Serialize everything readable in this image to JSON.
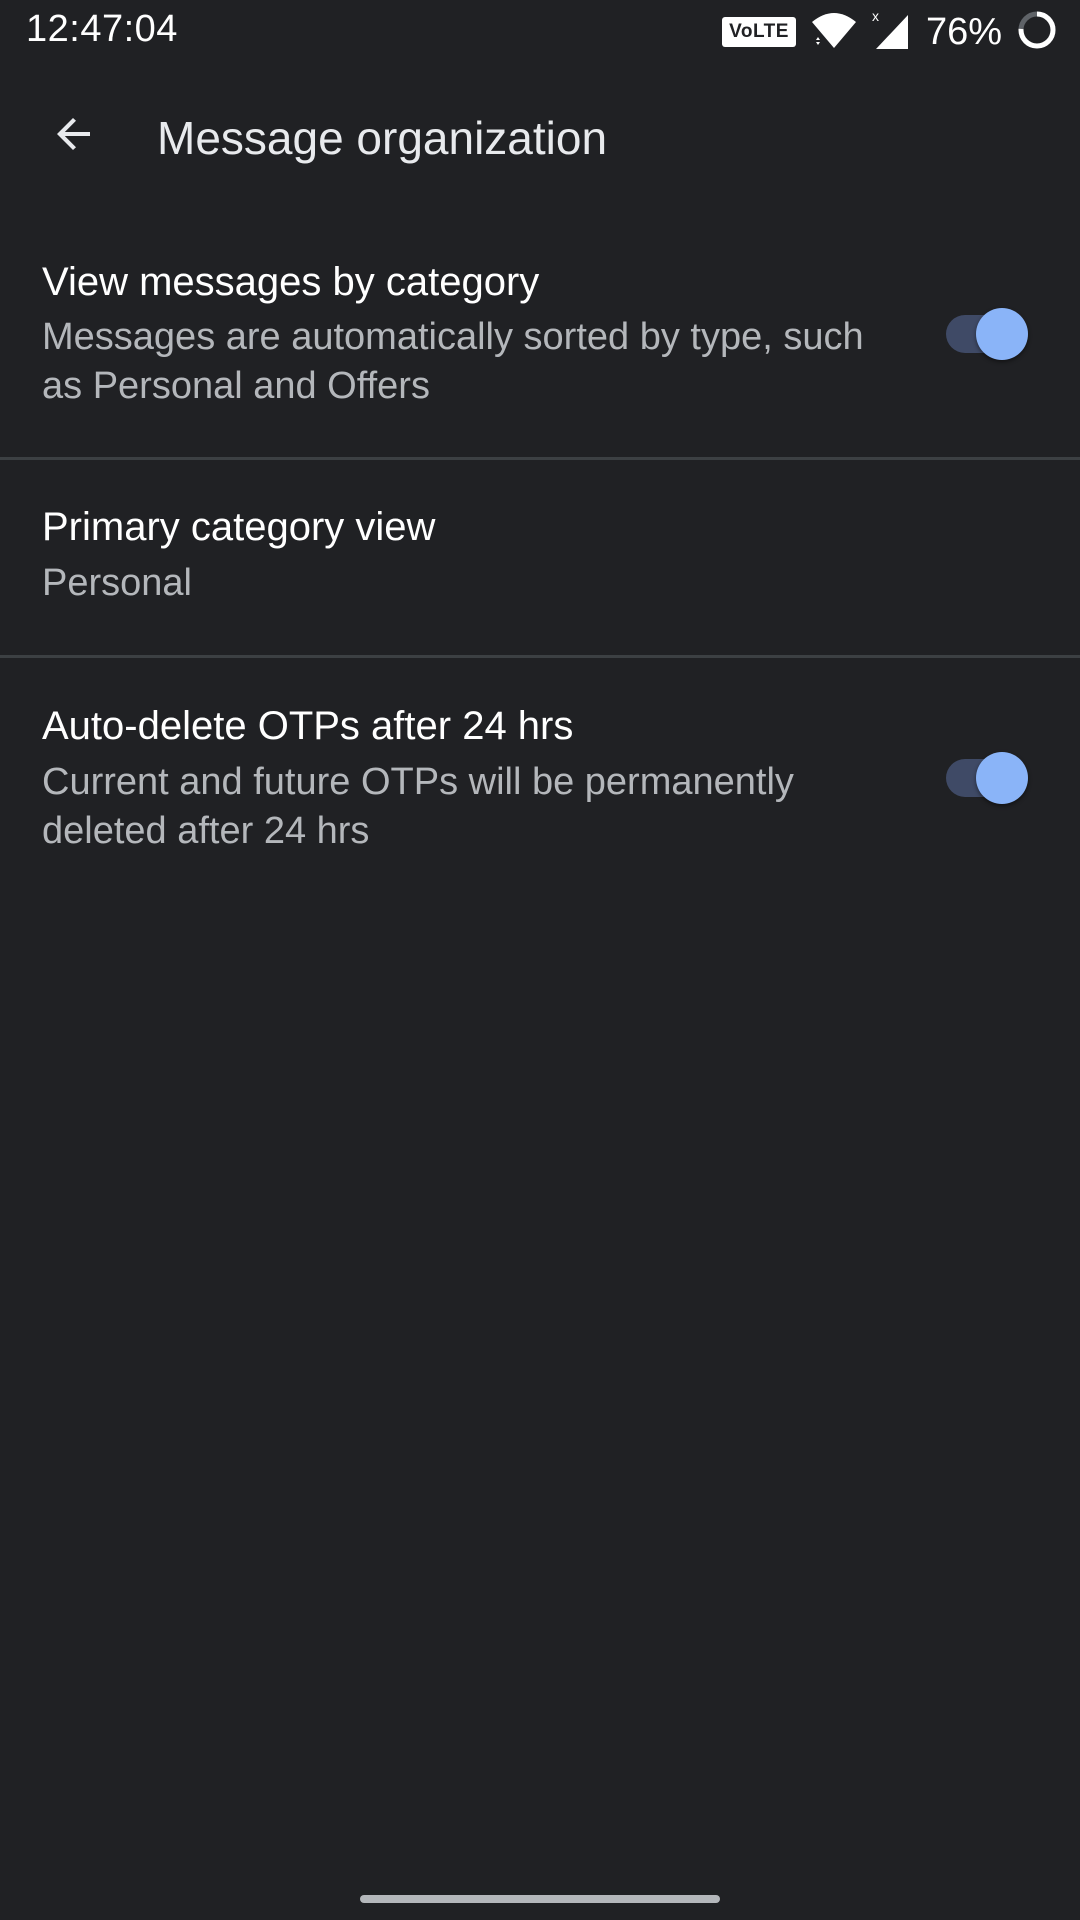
{
  "status_bar": {
    "time": "12:47:04",
    "volte": "VoLTE",
    "wifi_icon": "wifi-icon",
    "signal_icon": "cellular-signal-icon",
    "battery_percent": "76%",
    "battery_icon": "battery-ring-icon",
    "battery_level": 0.76
  },
  "app_bar": {
    "back_icon": "arrow-back-icon",
    "title": "Message organization"
  },
  "settings": [
    {
      "title": "View messages by category",
      "summary": "Messages are automatically sorted by type, such as Personal and Offers",
      "toggle_on": true
    },
    {
      "title": "Primary category view",
      "summary": "Personal"
    },
    {
      "title": "Auto-delete OTPs after 24 hrs",
      "summary": "Current and future OTPs will be permanently deleted after 24 hrs",
      "toggle_on": true
    }
  ],
  "colors": {
    "background": "#202124",
    "accent": "#8ab4f8",
    "toggle_track": "#3f4a66",
    "divider": "#3c4043",
    "primary_text": "#ffffff",
    "secondary_text": "#b4b7bb"
  }
}
